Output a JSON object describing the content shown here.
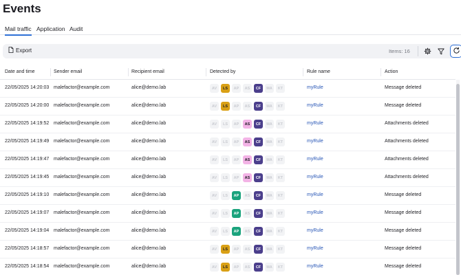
{
  "page": {
    "title": "Events"
  },
  "tabs": [
    {
      "label": "Mail traffic",
      "active": true
    },
    {
      "label": "Application",
      "active": false
    },
    {
      "label": "Audit",
      "active": false
    }
  ],
  "toolbar": {
    "export_label": "Export",
    "items_label": "Items: 16",
    "icons": [
      "settings-icon",
      "filter-icon",
      "refresh-icon"
    ]
  },
  "table": {
    "columns": [
      "Date and time",
      "Sender email",
      "Recipient email",
      "Detected by",
      "Rule name",
      "Action"
    ],
    "badge_codes": [
      "AV",
      "LS",
      "AP",
      "AS",
      "CF",
      "MA",
      "KT"
    ],
    "badge_colors": {
      "LS": "#d9a015",
      "AP": "#1ba37d",
      "AS": "#f3b3e6",
      "CF": "#4b3f8c"
    },
    "rows": [
      {
        "datetime": "22/05/2025 14:20:03",
        "sender": "malefactor@example.com",
        "recipient": "alice@demo.lab",
        "detected": [
          "LS",
          "CF"
        ],
        "rule": "myRule",
        "action": "Message deleted"
      },
      {
        "datetime": "22/05/2025 14:20:00",
        "sender": "malefactor@example.com",
        "recipient": "alice@demo.lab",
        "detected": [
          "LS",
          "CF"
        ],
        "rule": "myRule",
        "action": "Message deleted"
      },
      {
        "datetime": "22/05/2025 14:19:52",
        "sender": "malefactor@example.com",
        "recipient": "alice@demo.lab",
        "detected": [
          "AS",
          "CF"
        ],
        "rule": "myRule",
        "action": "Attachments deleted"
      },
      {
        "datetime": "22/05/2025 14:19:49",
        "sender": "malefactor@example.com",
        "recipient": "alice@demo.lab",
        "detected": [
          "AS",
          "CF"
        ],
        "rule": "myRule",
        "action": "Attachments deleted"
      },
      {
        "datetime": "22/05/2025 14:19:47",
        "sender": "malefactor@example.com",
        "recipient": "alice@demo.lab",
        "detected": [
          "AS",
          "CF"
        ],
        "rule": "myRule",
        "action": "Attachments deleted"
      },
      {
        "datetime": "22/05/2025 14:19:45",
        "sender": "malefactor@example.com",
        "recipient": "alice@demo.lab",
        "detected": [
          "AS",
          "CF"
        ],
        "rule": "myRule",
        "action": "Attachments deleted"
      },
      {
        "datetime": "22/05/2025 14:19:10",
        "sender": "malefactor@example.com",
        "recipient": "alice@demo.lab",
        "detected": [
          "AP",
          "CF"
        ],
        "rule": "myRule",
        "action": "Message deleted"
      },
      {
        "datetime": "22/05/2025 14:19:07",
        "sender": "malefactor@example.com",
        "recipient": "alice@demo.lab",
        "detected": [
          "AP",
          "CF"
        ],
        "rule": "myRule",
        "action": "Message deleted"
      },
      {
        "datetime": "22/05/2025 14:19:04",
        "sender": "malefactor@example.com",
        "recipient": "alice@demo.lab",
        "detected": [
          "AP",
          "CF"
        ],
        "rule": "myRule",
        "action": "Message deleted"
      },
      {
        "datetime": "22/05/2025 14:18:57",
        "sender": "malefactor@example.com",
        "recipient": "alice@demo.lab",
        "detected": [
          "LS",
          "CF"
        ],
        "rule": "myRule",
        "action": "Message deleted"
      },
      {
        "datetime": "22/05/2025 14:18:54",
        "sender": "malefactor@example.com",
        "recipient": "alice@demo.lab",
        "detected": [
          "LS",
          "CF"
        ],
        "rule": "myRule",
        "action": "Message deleted"
      }
    ]
  }
}
